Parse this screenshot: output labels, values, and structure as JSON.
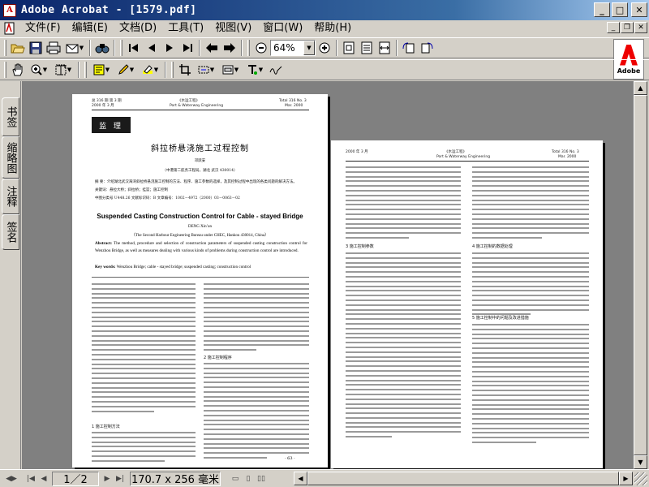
{
  "window": {
    "title": "Adobe Acrobat - [1579.pdf]",
    "app_icon_letter": "A"
  },
  "menu": {
    "items": [
      "文件(F)",
      "编辑(E)",
      "文档(D)",
      "工具(T)",
      "视图(V)",
      "窗口(W)",
      "帮助(H)"
    ]
  },
  "toolbar": {
    "zoom_value": "64%"
  },
  "logo": {
    "text": "Adobe"
  },
  "nav_tabs": [
    "书签",
    "缩略图",
    "注释",
    "签名"
  ],
  "page1": {
    "header_left_1": "总 316 期 第 3 期",
    "header_left_2": "2000 年 3 月",
    "header_center_1": "《水运工程》",
    "header_center_2": "Port & Waterway Engineering",
    "header_right_1": "Total 316 No. 3",
    "header_right_2": "Mar. 2000",
    "section": "监 理",
    "cn_title": "斜拉桥悬浇施工过程控制",
    "author_cn": "邓跃安",
    "affil_cn": "（中港第二航务工程局，湖北  武汉  430014）",
    "abstract_cn_1": "摘  要：介绍湖北武汉海湾斜拉桥悬浇施工控制的方法、程序、施工参数的选择，及其控制过程中出现的各类问题的解决方法。",
    "keywords_cn": "关键词：悬拉大桥；斜拉桥；挂篮；施工控制",
    "class_cn": "中图分类号 U448.26  文献标识码：B  文章编号：1002－4972（2000）03－0063－02",
    "en_title": "Suspended Casting Construction Control for Cable - stayed Bridge",
    "en_author": "DENG Xin’an",
    "en_affil": "（The Second Harbour Engineering Bureau under CHEC, Hankou 430014, China）",
    "abstract_label": "Abstract:",
    "abstract_text": " The method, procedure and selection of construction parameters of suspended casting construction control for Wenzhou Bridge, as well as measures dealing with various kinds of problems during construction control are introduced.",
    "keywords_label": "Key words:",
    "keywords_text": " Wenzhou Bridge; cable - stayed bridge; suspended casting; construction control",
    "left_heading": "1  施工控制方法",
    "right_heading_1": "2  施工控制程序",
    "page_number": "· 63 ·"
  },
  "page2": {
    "header_left_1": "2000 年 3 月",
    "header_center_1": "《水运工程》",
    "header_center_2": "Port & Waterway Engineering",
    "header_right_1": "Total 316 No. 3",
    "header_right_2": "Mar. 2000",
    "left_heading": "3  施工控制参数",
    "right_heading_1": "4  施工控制的数据处理",
    "right_heading_2": "5  施工控制中的问题及改进措施"
  },
  "status": {
    "page_indicator": "1／2",
    "page_size": "170.7 x 256 毫米"
  }
}
